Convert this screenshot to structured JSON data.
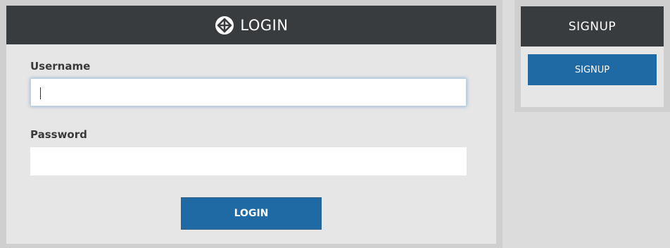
{
  "login": {
    "title": "LOGIN",
    "icon": "logo-icon",
    "username_label": "Username",
    "username_value": "",
    "password_label": "Password",
    "password_value": "",
    "button_label": "LOGIN"
  },
  "signup": {
    "title": "SIGNUP",
    "button_label": "SIGNUP"
  },
  "colors": {
    "header_bg": "#383c3f",
    "panel_bg": "#e6e6e6",
    "panel_border": "#cfcfcf",
    "button_bg": "#1f6aa5",
    "page_bg": "#dcdcdc"
  }
}
